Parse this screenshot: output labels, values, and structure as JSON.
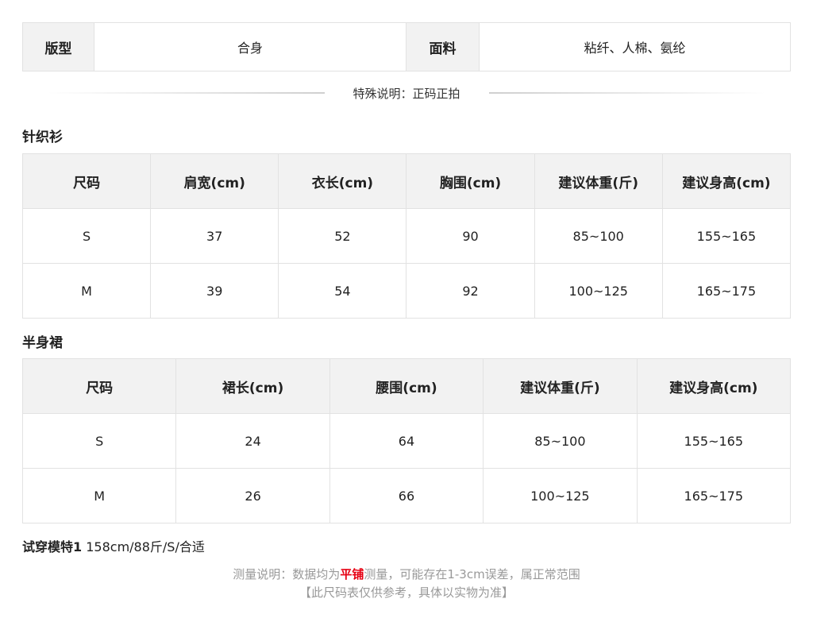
{
  "info": {
    "fit_label": "版型",
    "fit_value": "合身",
    "fabric_label": "面料",
    "fabric_value": "粘纤、人棉、氨纶"
  },
  "special_note": "特殊说明：正码正拍",
  "knit": {
    "title": "针织衫",
    "headers": [
      "尺码",
      "肩宽(cm)",
      "衣长(cm)",
      "胸围(cm)",
      "建议体重(斤)",
      "建议身高(cm)"
    ],
    "rows": [
      [
        "S",
        "37",
        "52",
        "90",
        "85~100",
        "155~165"
      ],
      [
        "M",
        "39",
        "54",
        "92",
        "100~125",
        "165~175"
      ]
    ]
  },
  "skirt": {
    "title": "半身裙",
    "headers": [
      "尺码",
      "裙长(cm)",
      "腰围(cm)",
      "建议体重(斤)",
      "建议身高(cm)"
    ],
    "rows": [
      [
        "S",
        "24",
        "64",
        "85~100",
        "155~165"
      ],
      [
        "M",
        "26",
        "66",
        "100~125",
        "165~175"
      ]
    ]
  },
  "model": {
    "label": "试穿模特1",
    "value": "158cm/88斤/S/合适"
  },
  "footnote": {
    "prefix": "测量说明：数据均为",
    "highlight": "平铺",
    "suffix": "测量，可能存在1-3cm误差，属正常范围",
    "disclaimer": "【此尺码表仅供参考，具体以实物为准】"
  },
  "colors": {
    "border": "#e2e2e2",
    "header_bg": "#f2f2f2",
    "highlight": "#e60012",
    "muted_text": "#999999"
  }
}
